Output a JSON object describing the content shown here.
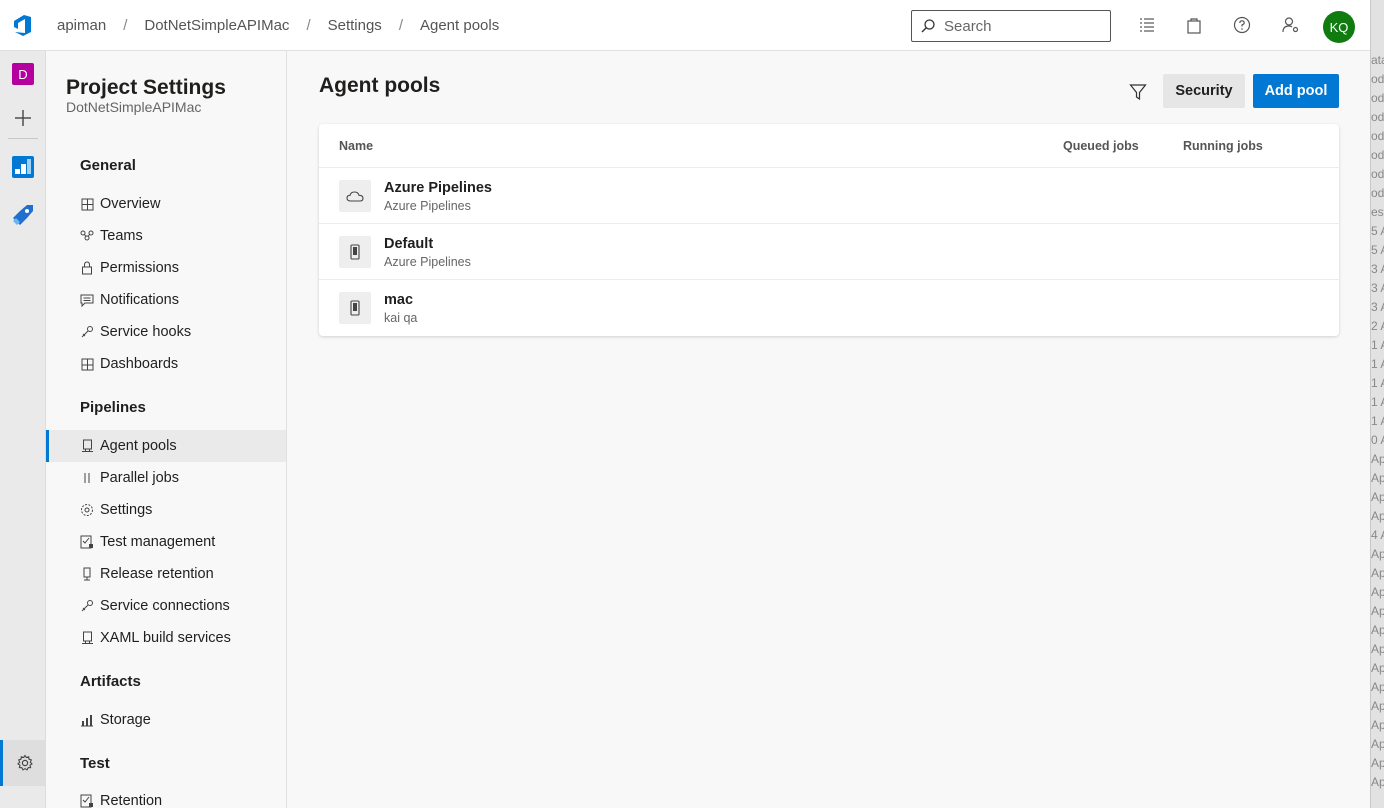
{
  "header": {
    "logo_icon": "azure-devops-icon",
    "breadcrumb": [
      "apiman",
      "DotNetSimpleAPIMac",
      "Settings",
      "Agent pools"
    ],
    "breadcrumb_separator": "/",
    "search_placeholder": "Search",
    "avatar_initials": "KQ",
    "avatar_color": "#107c10"
  },
  "rail": {
    "project_initial": "D",
    "project_color": "#b4009e"
  },
  "settings_nav": {
    "title": "Project Settings",
    "subtitle": "DotNetSimpleAPIMac",
    "groups": [
      {
        "heading": "General",
        "items": [
          "Overview",
          "Teams",
          "Permissions",
          "Notifications",
          "Service hooks",
          "Dashboards"
        ]
      },
      {
        "heading": "Pipelines",
        "items": [
          "Agent pools",
          "Parallel jobs",
          "Settings",
          "Test management",
          "Release retention",
          "Service connections",
          "XAML build services"
        ]
      },
      {
        "heading": "Artifacts",
        "items": [
          "Storage"
        ]
      },
      {
        "heading": "Test",
        "items": [
          "Retention"
        ]
      }
    ],
    "selected": "Agent pools"
  },
  "main": {
    "title": "Agent pools",
    "security_label": "Security",
    "add_label": "Add pool",
    "accent_color": "#0078d4",
    "columns": [
      "Name",
      "Queued jobs",
      "Running jobs"
    ],
    "rows": [
      {
        "name": "Azure Pipelines",
        "sub": "Azure Pipelines",
        "icon": "cloud-icon"
      },
      {
        "name": "Default",
        "sub": "Azure Pipelines",
        "icon": "agent-device-icon"
      },
      {
        "name": "mac",
        "sub": "kai qa",
        "icon": "agent-device-icon"
      }
    ]
  },
  "edge_strip": [
    "ata",
    "od",
    "od",
    "od",
    "od",
    "od",
    "od",
    "od",
    "est",
    "5 A",
    "5 A",
    "3 A",
    "3 A",
    "3 A",
    "2 A",
    "1 A",
    "1 A",
    "1 A",
    "1 A",
    "1 A",
    "0 A",
    "Ap",
    "Ap",
    "Ap",
    "Ap",
    "4 A",
    "Ap",
    "Ap",
    "Ap",
    "Ap",
    "Ap",
    "Ap",
    "Ap",
    "Ap",
    "Ap",
    "Ap",
    "Ap",
    "Ap",
    "Ap"
  ]
}
